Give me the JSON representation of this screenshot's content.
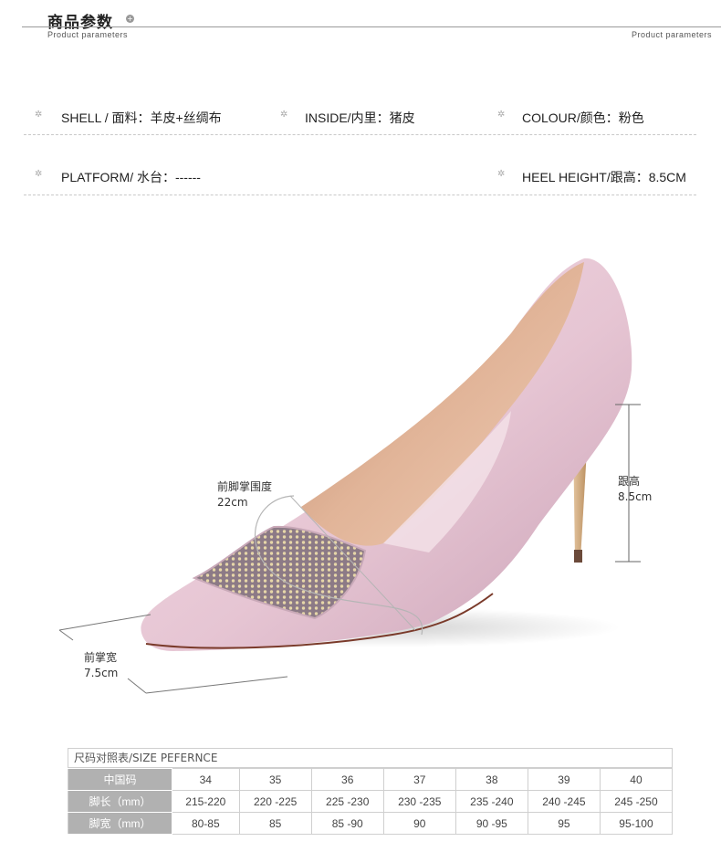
{
  "header": {
    "title": "商品参数",
    "subtitle_left": "Product parameters",
    "subtitle_right": "Product parameters"
  },
  "params": {
    "shell": "SHELL / 面料：羊皮+丝绸布",
    "inside": "INSIDE/内里：猪皮",
    "colour": "COLOUR/颜色：粉色",
    "platform": "PLATFORM/ 水台：------",
    "heel_height": "HEEL HEIGHT/跟高：8.5CM"
  },
  "annotations": {
    "forefoot_girth_label": "前脚掌围度",
    "forefoot_girth_value": "22cm",
    "heel_label": "跟高",
    "heel_value": "8.5cm",
    "forefoot_width_label": "前掌宽",
    "forefoot_width_value": "7.5cm"
  },
  "size_table": {
    "caption": "尺码对照表/SIZE PEFERNCE",
    "rows": [
      {
        "label": "中国码",
        "cells": [
          "34",
          "35",
          "36",
          "37",
          "38",
          "39",
          "40"
        ]
      },
      {
        "label": "脚长（mm）",
        "cells": [
          "215-220",
          "220 -225",
          "225 -230",
          "230 -235",
          "235 -240",
          "240 -245",
          "245 -250"
        ]
      },
      {
        "label": "脚宽（mm）",
        "cells": [
          "80-85",
          "85",
          "85 -90",
          "90",
          "90 -95",
          "95",
          "95-100"
        ]
      }
    ]
  },
  "colors": {
    "shoe_pink": "#e8c9d6",
    "lining": "#d9a98c",
    "table_label_bg": "#b1b1b1"
  }
}
